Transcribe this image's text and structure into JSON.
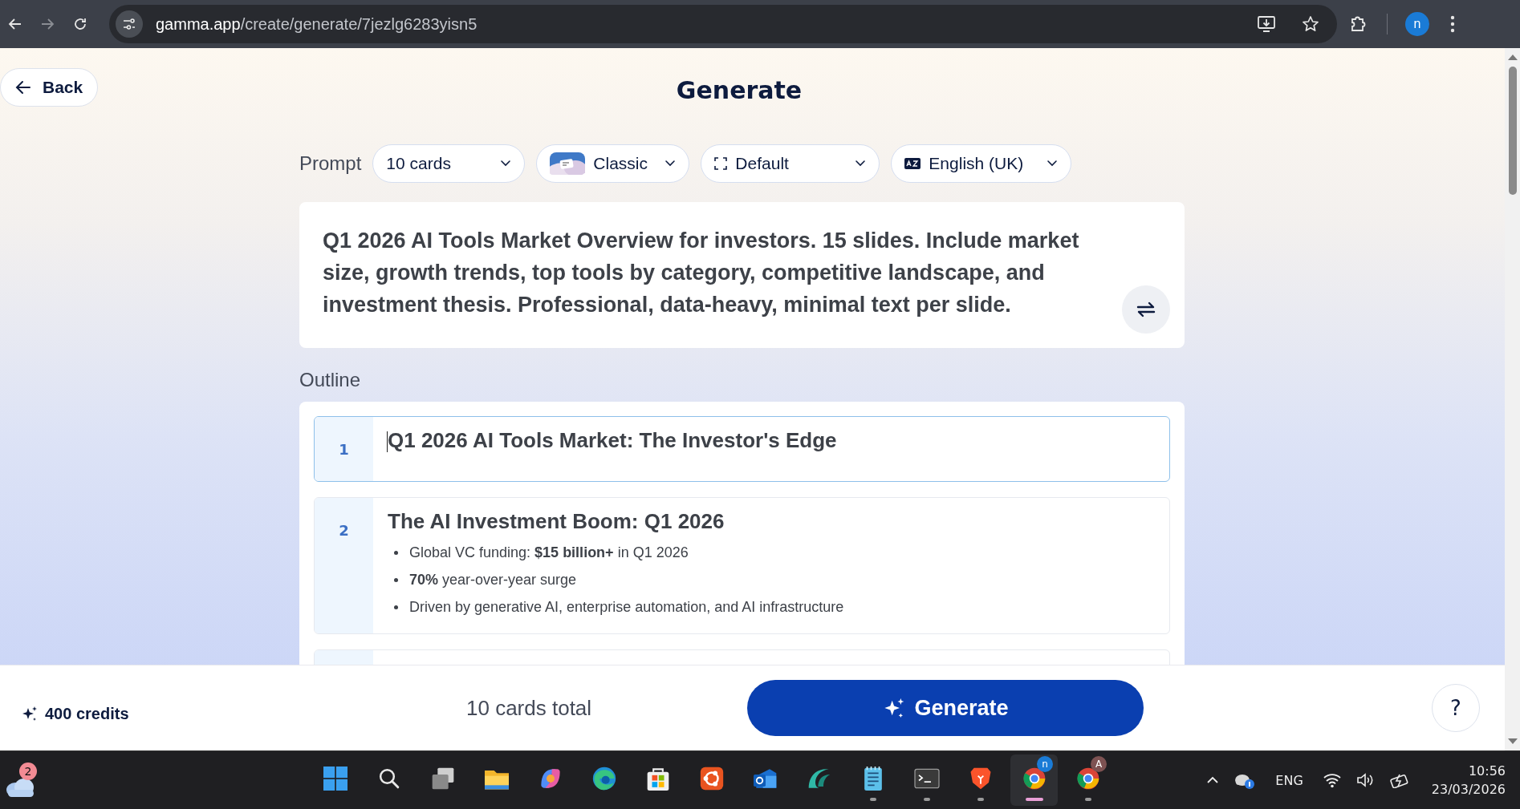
{
  "browser": {
    "url_host": "gamma.app",
    "url_path": "/create/generate/7jezlg6283yisn5",
    "profile": "n"
  },
  "header": {
    "back": "Back",
    "title": "Generate"
  },
  "prompt_bar": {
    "label": "Prompt",
    "dropdowns": [
      {
        "kind": "count",
        "label": "10 cards"
      },
      {
        "kind": "theme",
        "label": "Classic"
      },
      {
        "kind": "format",
        "label": "Default"
      },
      {
        "kind": "language",
        "label": "English (UK)"
      }
    ]
  },
  "prompt": {
    "text": "Q1 2026 AI Tools Market Overview for investors. 15 slides. Include market size, growth trends, top tools by category, competitive landscape, and investment thesis. Professional, data-heavy, minimal text per slide."
  },
  "outline": {
    "label": "Outline",
    "items": [
      {
        "number": "1",
        "title": "Q1 2026 AI Tools Market: The Investor's Edge",
        "focused": true
      },
      {
        "number": "2",
        "title": "The AI Investment Boom: Q1 2026",
        "focused": false,
        "bullets": [
          "Global VC funding: **$15 billion+** in Q1 2026",
          "**70%** year-over-year surge",
          "Driven by generative AI, enterprise automation, and AI infrastructure"
        ]
      }
    ]
  },
  "footer": {
    "credits": "400 credits",
    "total": "10 cards total",
    "generate": "Generate",
    "help": "?"
  },
  "taskbar": {
    "weather_badge": "2",
    "apps": [
      {
        "kind": "windows",
        "running": false,
        "selected": false
      },
      {
        "kind": "search",
        "running": false,
        "selected": false
      },
      {
        "kind": "taskview",
        "running": false,
        "selected": false
      },
      {
        "kind": "folder",
        "running": false,
        "selected": false
      },
      {
        "kind": "copilot",
        "running": false,
        "selected": false
      },
      {
        "kind": "edge",
        "running": false,
        "selected": false
      },
      {
        "kind": "store",
        "running": false,
        "selected": false
      },
      {
        "kind": "ubuntu",
        "running": false,
        "selected": false
      },
      {
        "kind": "mail",
        "running": false,
        "selected": false
      },
      {
        "kind": "wave",
        "running": false,
        "selected": false
      },
      {
        "kind": "notepad",
        "running": true,
        "selected": false
      },
      {
        "kind": "terminal",
        "running": true,
        "selected": false
      },
      {
        "kind": "brave",
        "running": true,
        "selected": false
      },
      {
        "kind": "chrome",
        "running": true,
        "selected": true,
        "badge": "n"
      },
      {
        "kind": "chrome",
        "running": true,
        "selected": false,
        "badge": "A"
      }
    ],
    "language": "ENG",
    "time": "10:56",
    "date": "23/03/2026"
  }
}
